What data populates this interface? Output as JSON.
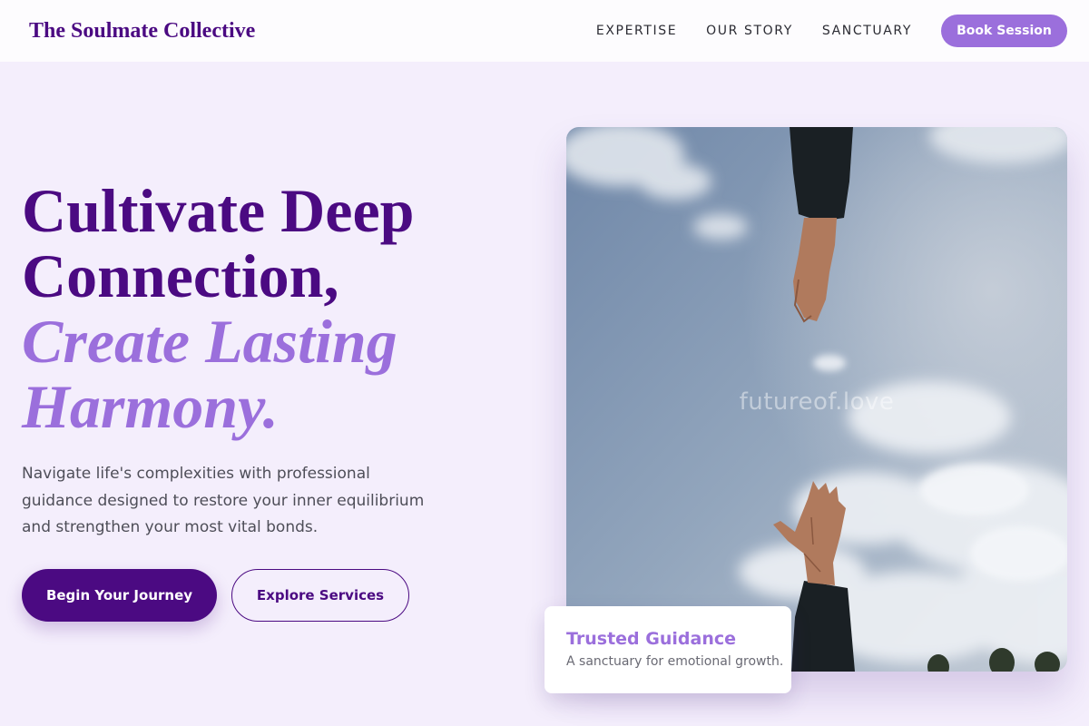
{
  "header": {
    "brand": "The Soulmate Collective",
    "nav": [
      "EXPERTISE",
      "OUR STORY",
      "SANCTUARY"
    ],
    "cta": "Book Session"
  },
  "hero": {
    "title_line1": "Cultivate Deep",
    "title_line2": "Connection,",
    "title_line3": "Create Lasting",
    "title_line4": "Harmony.",
    "description": "Navigate life's complexities with professional guidance designed to restore your inner equilibrium and strengthen your most vital bonds.",
    "primary_button": "Begin Your Journey",
    "secondary_button": "Explore Services"
  },
  "image": {
    "watermark": "futureof.love",
    "subject": "two hands reaching toward each other against a cloudy sky"
  },
  "card": {
    "title": "Trusted Guidance",
    "subtitle": "A sanctuary for emotional growth."
  },
  "colors": {
    "primary": "#4b0a82",
    "accent": "#9b6fdc",
    "background": "#f4eefc"
  }
}
